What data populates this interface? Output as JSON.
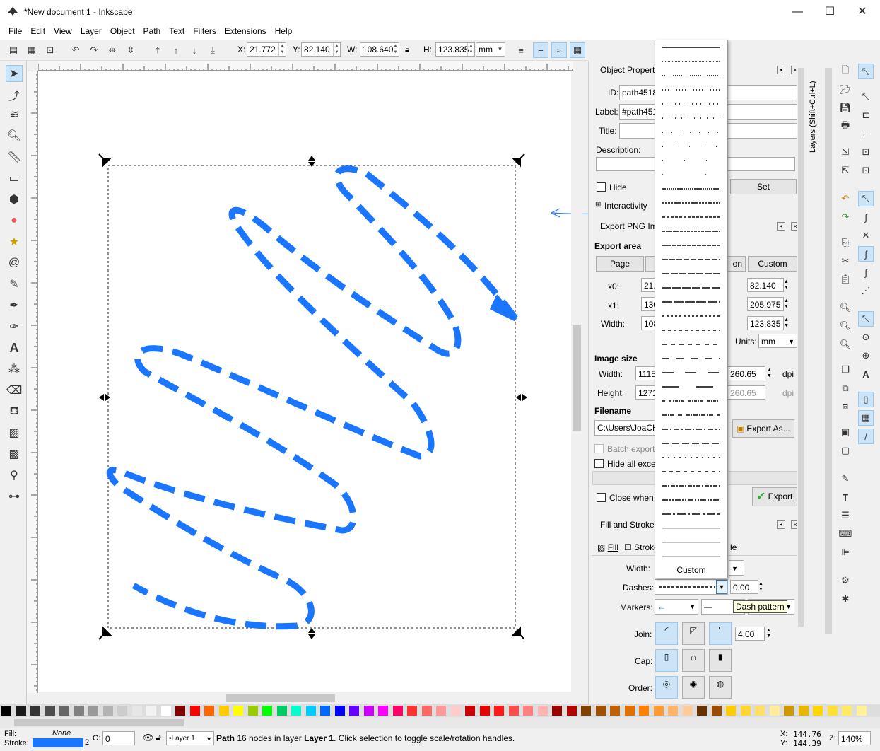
{
  "window": {
    "title": "*New document 1 - Inkscape",
    "minimize": "—",
    "maximize": "☐",
    "close": "✕"
  },
  "menu": [
    "File",
    "Edit",
    "View",
    "Layer",
    "Object",
    "Path",
    "Text",
    "Filters",
    "Extensions",
    "Help"
  ],
  "toolbar": {
    "x_label": "X:",
    "x_value": "21.772",
    "y_label": "Y:",
    "y_value": "82.140",
    "w_label": "W:",
    "w_value": "108.640",
    "h_label": "H:",
    "h_value": "123.835",
    "units": "mm"
  },
  "object_properties": {
    "header": "Object Properti",
    "id_label": "ID:",
    "id_value": "path4518",
    "label_label": "Label:",
    "label_value": "#path451",
    "title_label": "Title:",
    "description_label": "Description:",
    "hide_label": "Hide",
    "set_button": "Set",
    "interactivity_label": "Interactivity"
  },
  "export_png": {
    "header": "Export PNG Ima",
    "export_area": "Export area",
    "page_button": "Page",
    "selection_button_partial": "on",
    "custom_button": "Custom",
    "x0_label": "x0:",
    "x0_value": "21.",
    "y0_value": "82.140",
    "x1_label": "x1:",
    "x1_value": "130",
    "y1_value": "205.975",
    "width_label": "Width:",
    "width_value": "108",
    "height_value": "123.835",
    "units_label": "Units:",
    "units_value": "mm",
    "image_size": "Image size",
    "img_width_label": "Width:",
    "img_width_value": "1115",
    "img_height_label": "Height:",
    "img_height_value": "1271",
    "dpi_value": "260.65",
    "dpi_value2": "260.65",
    "dpi_label": "dpi",
    "filename": "Filename",
    "filename_value": "C:\\Users\\JoaCH",
    "export_as_button": "Export As...",
    "batch_export": "Batch export",
    "hide_all": "Hide all exce",
    "close_when": "Close when",
    "export_button": "Export"
  },
  "fill_stroke": {
    "header": "Fill and Stroke (",
    "tab_fill": "Fill",
    "tab_stroke": "Stroke",
    "tab_style_partial": "le",
    "width_label": "Width:",
    "dashes_label": "Dashes:",
    "dash_offset": "0.00",
    "markers_label": "Markers:",
    "join_label": "Join:",
    "miter_value": "4.00",
    "cap_label": "Cap:",
    "order_label": "Order:"
  },
  "dash_dropdown": {
    "custom_label": "Custom"
  },
  "tooltip": "Dash pattern",
  "layers_tab": "Layers (Shift+Ctrl+L)",
  "status": {
    "fill_label": "Fill:",
    "fill_value": "None",
    "stroke_label": "Stroke:",
    "stroke_width": "2",
    "opacity_label": "O:",
    "opacity_value": "0",
    "layer_value": "•Layer 1",
    "message_bold": "Path",
    "message_rest": " 16 nodes in layer ",
    "message_layer": "Layer 1",
    "message_tail": ". Click selection to toggle scale/rotation handles.",
    "x_label": "X:",
    "x_value": "144.76",
    "y_label": "Y:",
    "y_value": "144.39",
    "z_label": "Z:",
    "z_value": "140%"
  },
  "colors": {
    "accent_stroke": "#1a75ff",
    "selection_blue": "#cce4f7"
  }
}
